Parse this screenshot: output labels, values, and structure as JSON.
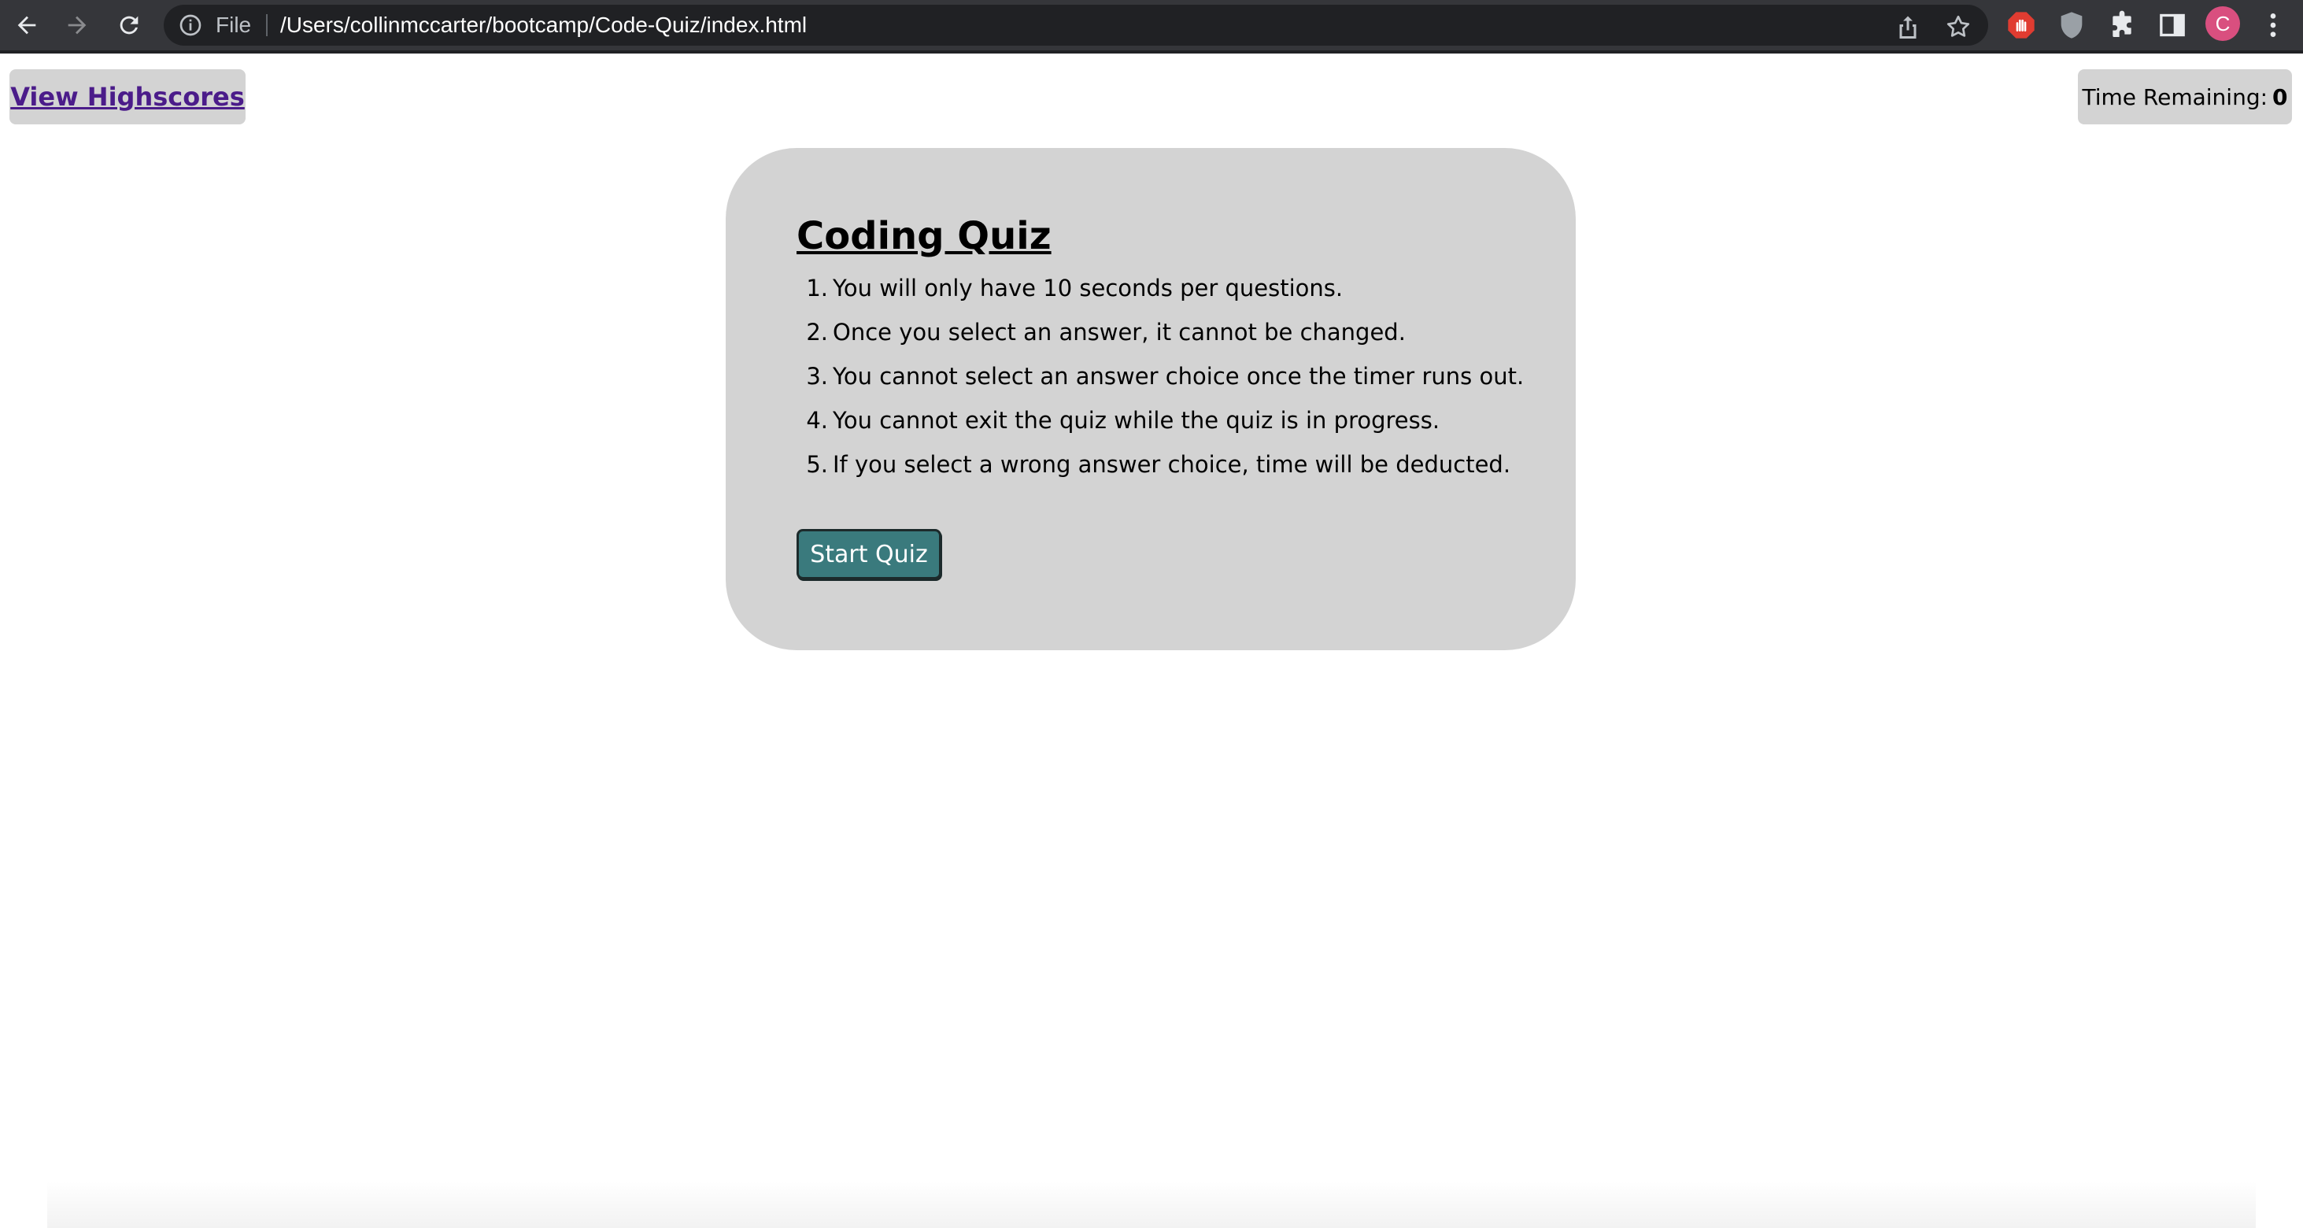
{
  "browser": {
    "scheme_label": "File",
    "url": "/Users/collinmccarter/bootcamp/Code-Quiz/index.html",
    "profile_initial": "C",
    "colors": {
      "toolbar_bg": "#35363a",
      "omnibox_bg": "#202124",
      "avatar_bg": "#d94f7f",
      "adblock_icon": "#e03c31"
    }
  },
  "header": {
    "highscores_link": "View Highscores",
    "timer_label": "Time Remaining:",
    "timer_value": "0"
  },
  "quiz": {
    "title": "Coding Quiz",
    "rules": [
      {
        "num": "1.",
        "text": "You will only have 10 seconds per questions."
      },
      {
        "num": "2.",
        "text": "Once you select an answer, it cannot be changed."
      },
      {
        "num": "3.",
        "text": "You cannot select an answer choice once the timer runs out."
      },
      {
        "num": "4.",
        "text": "You cannot exit the quiz while the quiz is in progress."
      },
      {
        "num": "5.",
        "text": "If you select a wrong answer choice, time will be deducted."
      }
    ],
    "start_button": "Start Quiz",
    "colors": {
      "card_bg": "#d3d3d3",
      "button_bg": "#3a7a7d",
      "link_color": "#4b1c8a"
    }
  }
}
